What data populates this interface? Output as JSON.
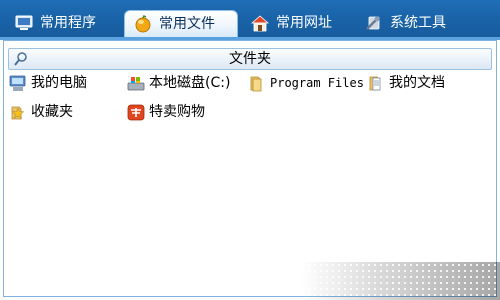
{
  "tabs": [
    {
      "label": "常用程序",
      "icon": "monitor-icon"
    },
    {
      "label": "常用文件",
      "icon": "gold-orb-icon",
      "active": true
    },
    {
      "label": "常用网址",
      "icon": "home-icon"
    },
    {
      "label": "系统工具",
      "icon": "tools-icon"
    }
  ],
  "crumb": {
    "title": "文件夹",
    "icon": "search-icon"
  },
  "items": [
    {
      "label": "我的电脑",
      "icon": "computer-icon"
    },
    {
      "label": "本地磁盘(C:)",
      "icon": "drive-icon"
    },
    {
      "label": "Program Files",
      "icon": "folder-icon"
    },
    {
      "label": "我的文档",
      "icon": "documents-icon"
    },
    {
      "label": "收藏夹",
      "icon": "favorites-folder-icon"
    },
    {
      "label": "特卖购物",
      "icon": "shop-icon"
    }
  ],
  "colors": {
    "tab_bar": "#1a63a8",
    "accent": "#5aa2df",
    "panel_border": "#7fb4e2"
  }
}
